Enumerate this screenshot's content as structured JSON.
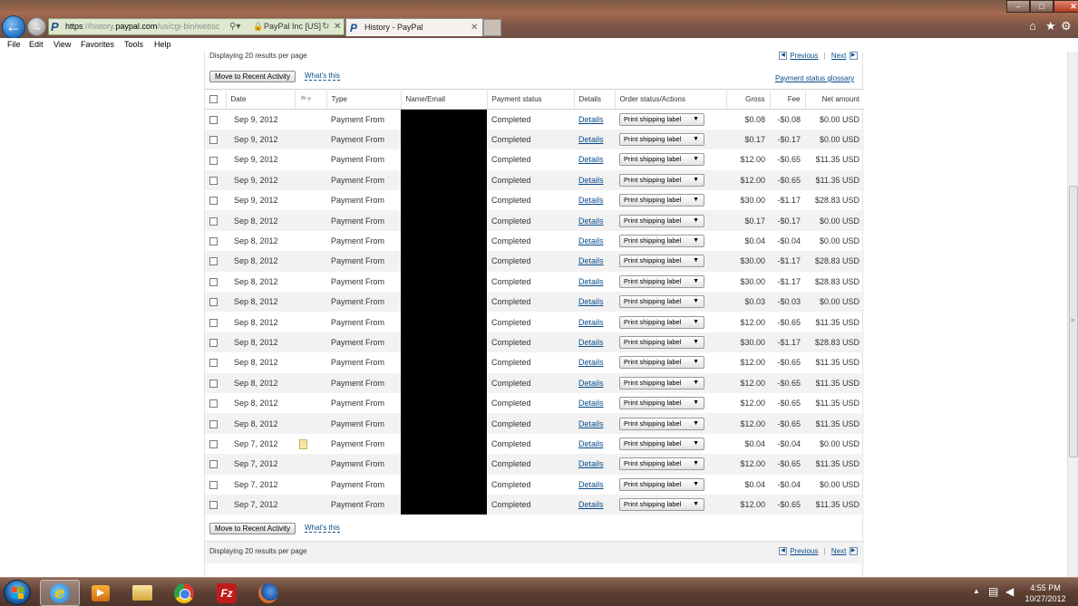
{
  "browser": {
    "url_scheme": "https",
    "url_host_pre": "://history.",
    "url_host": "paypal.com",
    "url_path": "/us/cgi-bin/websc",
    "cert_label": "PayPal Inc [US]",
    "tab_title": "History - PayPal",
    "menu": [
      "File",
      "Edit",
      "View",
      "Favorites",
      "Tools",
      "Help"
    ]
  },
  "page": {
    "results_per_page_text": "Displaying 20 results per page",
    "previous_label": "Previous",
    "next_label": "Next",
    "move_button_label": "Move to Recent Activity",
    "whats_this_label": "What's this",
    "glossary_label": "Payment status glossary",
    "columns": {
      "date": "Date",
      "type": "Type",
      "name_email": "Name/Email",
      "payment_status": "Payment status",
      "details": "Details",
      "order_status": "Order status/Actions",
      "gross": "Gross",
      "fee": "Fee",
      "net": "Net amount"
    },
    "rows": [
      {
        "date": "Sep 9, 2012",
        "type": "Payment From",
        "status": "Completed",
        "details": "Details",
        "action": "Print shipping label",
        "gross": "$0.08",
        "fee": "-$0.08",
        "net": "$0.00 USD"
      },
      {
        "date": "Sep 9, 2012",
        "type": "Payment From",
        "status": "Completed",
        "details": "Details",
        "action": "Print shipping label",
        "gross": "$0.17",
        "fee": "-$0.17",
        "net": "$0.00 USD"
      },
      {
        "date": "Sep 9, 2012",
        "type": "Payment From",
        "status": "Completed",
        "details": "Details",
        "action": "Print shipping label",
        "gross": "$12.00",
        "fee": "-$0.65",
        "net": "$11.35 USD"
      },
      {
        "date": "Sep 9, 2012",
        "type": "Payment From",
        "status": "Completed",
        "details": "Details",
        "action": "Print shipping label",
        "gross": "$12.00",
        "fee": "-$0.65",
        "net": "$11.35 USD"
      },
      {
        "date": "Sep 9, 2012",
        "type": "Payment From",
        "status": "Completed",
        "details": "Details",
        "action": "Print shipping label",
        "gross": "$30.00",
        "fee": "-$1.17",
        "net": "$28.83 USD"
      },
      {
        "date": "Sep 8, 2012",
        "type": "Payment From",
        "status": "Completed",
        "details": "Details",
        "action": "Print shipping label",
        "gross": "$0.17",
        "fee": "-$0.17",
        "net": "$0.00 USD"
      },
      {
        "date": "Sep 8, 2012",
        "type": "Payment From",
        "status": "Completed",
        "details": "Details",
        "action": "Print shipping label",
        "gross": "$0.04",
        "fee": "-$0.04",
        "net": "$0.00 USD"
      },
      {
        "date": "Sep 8, 2012",
        "type": "Payment From",
        "status": "Completed",
        "details": "Details",
        "action": "Print shipping label",
        "gross": "$30.00",
        "fee": "-$1.17",
        "net": "$28.83 USD"
      },
      {
        "date": "Sep 8, 2012",
        "type": "Payment From",
        "status": "Completed",
        "details": "Details",
        "action": "Print shipping label",
        "gross": "$30.00",
        "fee": "-$1.17",
        "net": "$28.83 USD"
      },
      {
        "date": "Sep 8, 2012",
        "type": "Payment From",
        "status": "Completed",
        "details": "Details",
        "action": "Print shipping label",
        "gross": "$0.03",
        "fee": "-$0.03",
        "net": "$0.00 USD"
      },
      {
        "date": "Sep 8, 2012",
        "type": "Payment From",
        "status": "Completed",
        "details": "Details",
        "action": "Print shipping label",
        "gross": "$12.00",
        "fee": "-$0.65",
        "net": "$11.35 USD"
      },
      {
        "date": "Sep 8, 2012",
        "type": "Payment From",
        "status": "Completed",
        "details": "Details",
        "action": "Print shipping label",
        "gross": "$30.00",
        "fee": "-$1.17",
        "net": "$28.83 USD"
      },
      {
        "date": "Sep 8, 2012",
        "type": "Payment From",
        "status": "Completed",
        "details": "Details",
        "action": "Print shipping label",
        "gross": "$12.00",
        "fee": "-$0.65",
        "net": "$11.35 USD"
      },
      {
        "date": "Sep 8, 2012",
        "type": "Payment From",
        "status": "Completed",
        "details": "Details",
        "action": "Print shipping label",
        "gross": "$12.00",
        "fee": "-$0.65",
        "net": "$11.35 USD"
      },
      {
        "date": "Sep 8, 2012",
        "type": "Payment From",
        "status": "Completed",
        "details": "Details",
        "action": "Print shipping label",
        "gross": "$12.00",
        "fee": "-$0.65",
        "net": "$11.35 USD"
      },
      {
        "date": "Sep 8, 2012",
        "type": "Payment From",
        "status": "Completed",
        "details": "Details",
        "action": "Print shipping label",
        "gross": "$12.00",
        "fee": "-$0.65",
        "net": "$11.35 USD"
      },
      {
        "date": "Sep 7, 2012",
        "type": "Payment From",
        "status": "Completed",
        "details": "Details",
        "action": "Print shipping label",
        "gross": "$0.04",
        "fee": "-$0.04",
        "net": "$0.00 USD",
        "has_note": true
      },
      {
        "date": "Sep 7, 2012",
        "type": "Payment From",
        "status": "Completed",
        "details": "Details",
        "action": "Print shipping label",
        "gross": "$12.00",
        "fee": "-$0.65",
        "net": "$11.35 USD"
      },
      {
        "date": "Sep 7, 2012",
        "type": "Payment From",
        "status": "Completed",
        "details": "Details",
        "action": "Print shipping label",
        "gross": "$0.04",
        "fee": "-$0.04",
        "net": "$0.00 USD"
      },
      {
        "date": "Sep 7, 2012",
        "type": "Payment From",
        "status": "Completed",
        "details": "Details",
        "action": "Print shipping label",
        "gross": "$12.00",
        "fee": "-$0.65",
        "net": "$11.35 USD"
      }
    ]
  },
  "taskbar": {
    "time": "4:55 PM",
    "date": "10/27/2012",
    "apps": [
      "ie-icon",
      "media-player-icon",
      "folder-icon",
      "chrome-icon",
      "filezilla-icon",
      "firefox-icon"
    ]
  },
  "colors": {
    "link": "#084b8a",
    "row_alt": "#f2f2f2",
    "redaction": "#000000"
  }
}
